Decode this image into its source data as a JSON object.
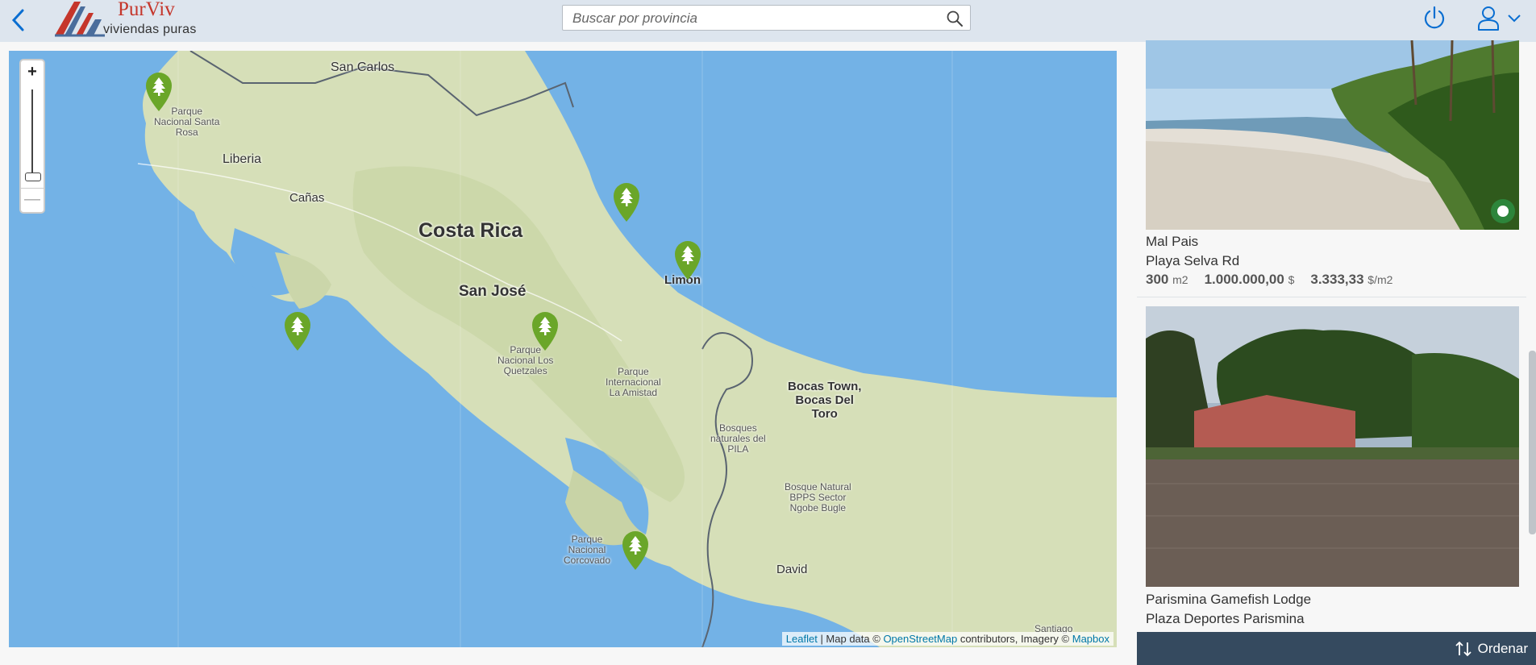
{
  "header": {
    "logo_title": "PurViv",
    "logo_subtitle": "viviendas puras",
    "search_placeholder": "Buscar por provincia",
    "icons": [
      "back-icon",
      "search-icon",
      "power-icon",
      "user-icon",
      "chevron-down-icon"
    ]
  },
  "map": {
    "zoom_in": "+",
    "zoom_out": "—",
    "labels": {
      "san_carlos": "San Carlos",
      "parque_santa_rosa": "Parque\nNacional Santa\nRosa",
      "liberia": "Liberia",
      "canas": "Cañas",
      "costa_rica": "Costa Rica",
      "san_jose": "San José",
      "limon": "Limón",
      "quetzales": "Parque\nNacional Los\nQuetzales",
      "amistad": "Parque\nInternacional\nLa Amistad",
      "bocas": "Bocas Town,\nBocas Del\nToro",
      "bosques": "Bosques\nnaturales del\nPILA",
      "bosque_natural": "Bosque Natural\nBPPS Sector\nNgobe Bugle",
      "corcovado": "Parque\nNacional\nCorcovado",
      "david": "David",
      "santiago": "Santiago"
    },
    "attribution": {
      "leaflet": "Leaflet",
      "sep": " | Map data © ",
      "osm": "OpenStreetMap",
      "mid": " contributors, Imagery © ",
      "mapbox": "Mapbox"
    },
    "marker_color": "#6aa629"
  },
  "listings": [
    {
      "name": "Mal Pais",
      "address": "Playa Selva Rd",
      "area": "300",
      "area_unit": "m2",
      "price": "1.000.000,00",
      "price_unit": "$",
      "price_per_m2": "3.333,33",
      "price_per_m2_unit": "$/m2"
    },
    {
      "name": "Parismina Gamefish Lodge",
      "address": "Plaza Deportes Parismina"
    }
  ],
  "footer": {
    "sort_label": "Ordenar"
  },
  "colors": {
    "shell": "#dde5ee",
    "footer": "#354a5f",
    "water": "#73b2e6",
    "land": "#d6dfb8",
    "logo_red": "#c5362b"
  }
}
